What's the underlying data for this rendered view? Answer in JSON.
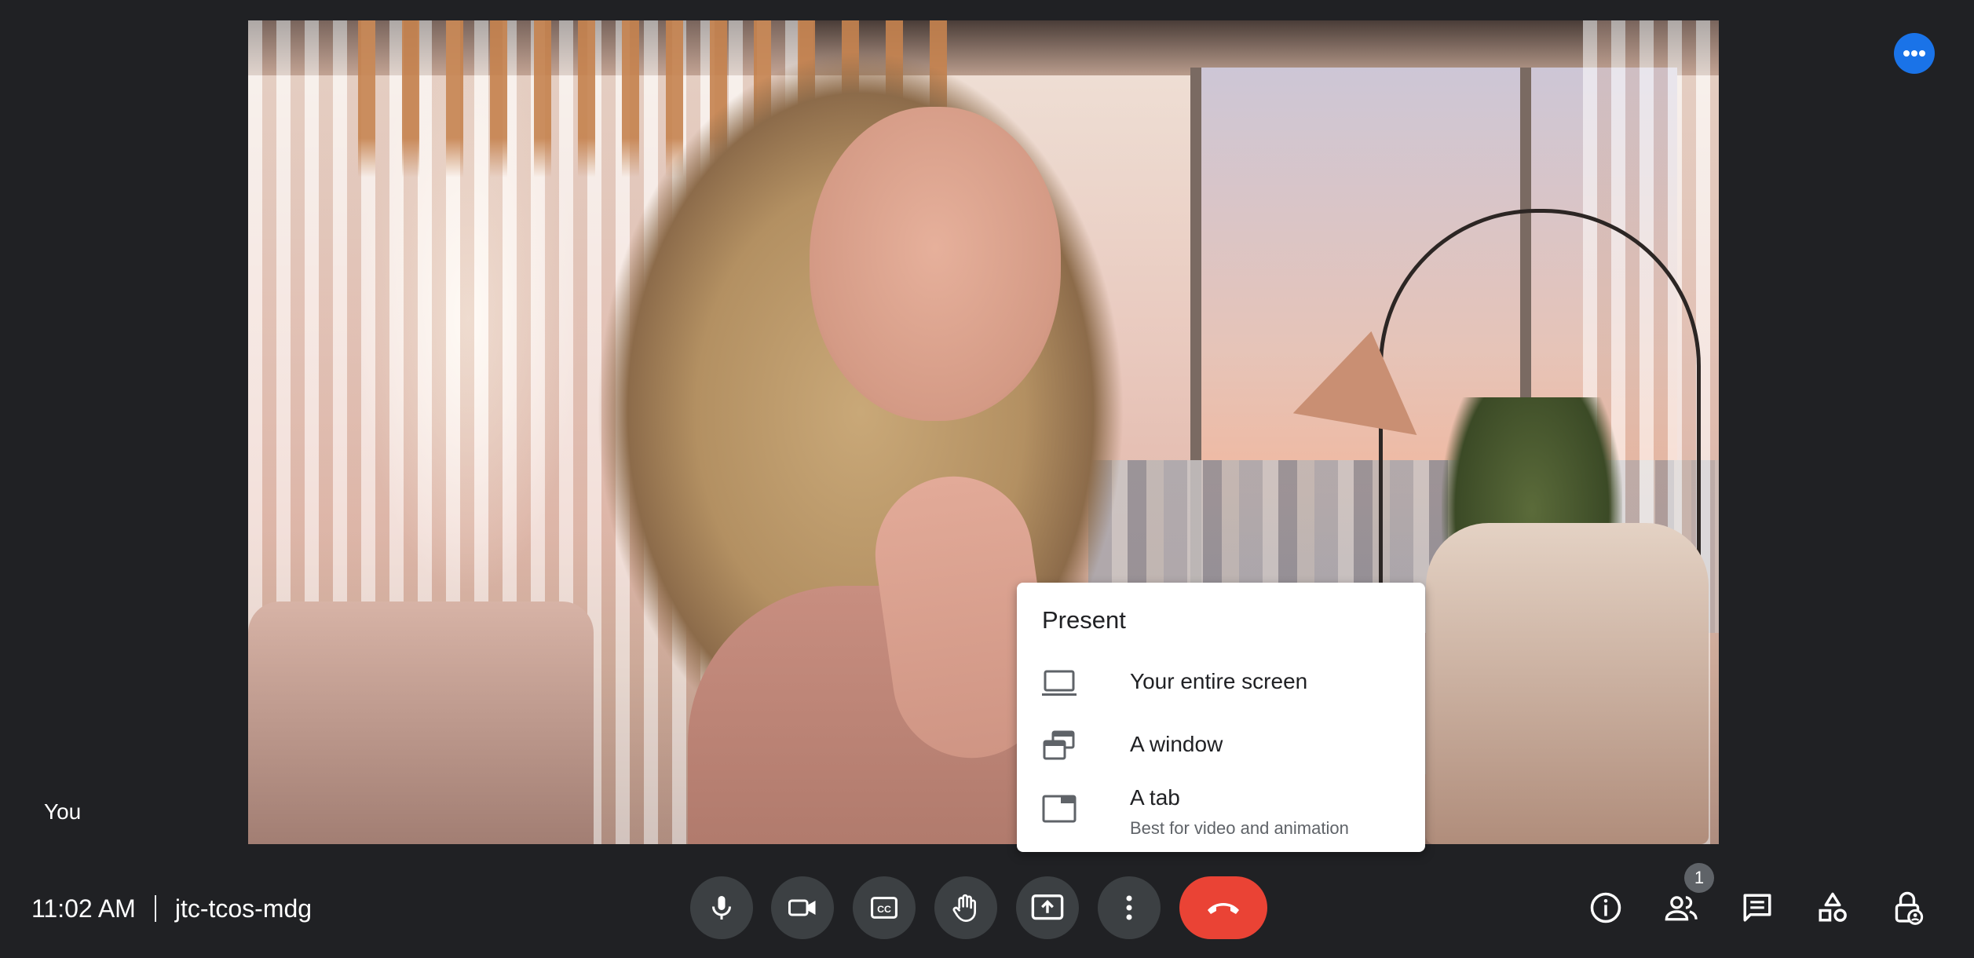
{
  "participant": {
    "name": "You"
  },
  "present_menu": {
    "title": "Present",
    "items": [
      {
        "label": "Your entire screen",
        "icon": "laptop-icon"
      },
      {
        "label": "A window",
        "icon": "window-icon"
      },
      {
        "label": "A tab",
        "sublabel": "Best for video and animation",
        "icon": "tab-icon"
      }
    ]
  },
  "meeting": {
    "time": "11:02 AM",
    "code": "jtc-tcos-mdg"
  },
  "controls": [
    {
      "name": "microphone",
      "icon": "microphone-icon"
    },
    {
      "name": "camera",
      "icon": "camera-icon"
    },
    {
      "name": "captions",
      "icon": "captions-icon"
    },
    {
      "name": "raise-hand",
      "icon": "hand-icon"
    },
    {
      "name": "present-now",
      "icon": "present-icon"
    },
    {
      "name": "more-options",
      "icon": "more-vert-icon"
    },
    {
      "name": "leave-call",
      "icon": "end-call-icon",
      "color": "#ea4335"
    }
  ],
  "side_controls": {
    "people_count": "1",
    "icons": [
      "info-icon",
      "people-icon",
      "chat-icon",
      "activities-icon",
      "host-controls-icon"
    ]
  },
  "colors": {
    "background": "#202124",
    "button": "#3c4043",
    "end_call": "#ea4335",
    "accent": "#1a73e8"
  }
}
